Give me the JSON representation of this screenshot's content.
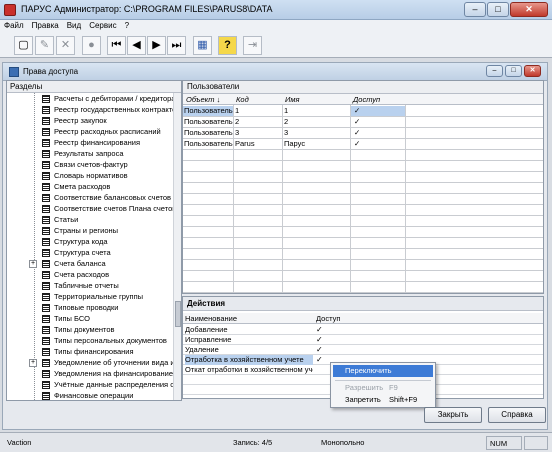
{
  "window": {
    "title": "ПАРУС Администратор: C:\\PROGRAM FILES\\PARUS8\\DATA",
    "minimize": "–",
    "maximize": "□",
    "close": "✕"
  },
  "menu": [
    "Файл",
    "Правка",
    "Вид",
    "Сервис",
    "?"
  ],
  "toolbar": {
    "icons": [
      "new-doc-icon",
      "edit-doc-icon",
      "delete-icon",
      "stop-icon",
      "first-record-icon",
      "prev-record-icon",
      "next-record-icon",
      "last-record-icon",
      "calendar-icon",
      "help-icon",
      "exit-icon"
    ],
    "glyphs": [
      "▢",
      "✎",
      "✕",
      "●",
      "⏮",
      "◀",
      "▶",
      "⏭",
      "▦",
      "?",
      "⇥"
    ]
  },
  "subwindow": {
    "title": "Права доступа"
  },
  "sections": {
    "header": "Разделы",
    "items": [
      {
        "label": "Расчеты с дебиторами / кредиторами",
        "expandable": false
      },
      {
        "label": "Реестр государственных контрактов",
        "expandable": false
      },
      {
        "label": "Реестр закупок",
        "expandable": false
      },
      {
        "label": "Реестр расходных расписаний",
        "expandable": false
      },
      {
        "label": "Реестр финансирования",
        "expandable": false
      },
      {
        "label": "Результаты запроса",
        "expandable": false
      },
      {
        "label": "Связи счетов-фактур",
        "expandable": false
      },
      {
        "label": "Словарь нормативов",
        "expandable": false
      },
      {
        "label": "Смета расходов",
        "expandable": false
      },
      {
        "label": "Соответствие балансовых счетов",
        "expandable": false
      },
      {
        "label": "Соответствие счетов Плана счетов",
        "expandable": false
      },
      {
        "label": "Статьи",
        "expandable": false
      },
      {
        "label": "Страны и регионы",
        "expandable": false
      },
      {
        "label": "Структура кода",
        "expandable": false
      },
      {
        "label": "Структура счета",
        "expandable": false
      },
      {
        "label": "Счета баланса",
        "expandable": true
      },
      {
        "label": "Счета расходов",
        "expandable": false
      },
      {
        "label": "Табличные отчеты",
        "expandable": false
      },
      {
        "label": "Территориальные группы",
        "expandable": false
      },
      {
        "label": "Типовые проводки",
        "expandable": false
      },
      {
        "label": "Типы БСО",
        "expandable": false
      },
      {
        "label": "Типы документов",
        "expandable": false
      },
      {
        "label": "Типы персональных документов",
        "expandable": false
      },
      {
        "label": "Типы финансирования",
        "expandable": false
      },
      {
        "label": "Уведомление об уточнении вида и",
        "expandable": true
      },
      {
        "label": "Уведомления на финансирование",
        "expandable": false
      },
      {
        "label": "Учётные данные распределения ср",
        "expandable": false
      },
      {
        "label": "Финансовые операции",
        "expandable": false
      }
    ]
  },
  "users": {
    "header": "Пользователи",
    "columns": [
      "Объект ↓",
      "Код",
      "Имя",
      "Доступ"
    ],
    "rows": [
      {
        "object": "Пользователь",
        "code": "1",
        "name": "1",
        "access": "✓",
        "selected": true
      },
      {
        "object": "Пользователь",
        "code": "2",
        "name": "2",
        "access": "✓",
        "selected": false
      },
      {
        "object": "Пользователь",
        "code": "3",
        "name": "3",
        "access": "✓",
        "selected": false
      },
      {
        "object": "Пользователь",
        "code": "Parus",
        "name": "Парус",
        "access": "✓",
        "selected": false
      }
    ]
  },
  "actions": {
    "header": "Действия",
    "columns": [
      "Наименование",
      "Доступ"
    ],
    "rows": [
      {
        "name": "Добавление",
        "access": "✓",
        "selected": false
      },
      {
        "name": "Исправление",
        "access": "✓",
        "selected": false
      },
      {
        "name": "Удаление",
        "access": "✓",
        "selected": false
      },
      {
        "name": "Отработка в хозяйственном учете",
        "access": "✓",
        "selected": true
      },
      {
        "name": "Откат отработки в хозяйственном уче",
        "access": "",
        "selected": false
      }
    ]
  },
  "context_menu": {
    "items": [
      {
        "label": "Переключить",
        "shortcut": "",
        "state": "highlighted"
      },
      {
        "label": "Разрешить",
        "shortcut": "F9",
        "state": "disabled"
      },
      {
        "label": "Запретить",
        "shortcut": "Shift+F9",
        "state": "normal"
      }
    ]
  },
  "buttons": {
    "close": "Закрыть",
    "help": "Справка"
  },
  "status": {
    "user": "Vaction",
    "record": "Запись: 4/5",
    "mode": "Монопольно",
    "num": "NUM"
  }
}
